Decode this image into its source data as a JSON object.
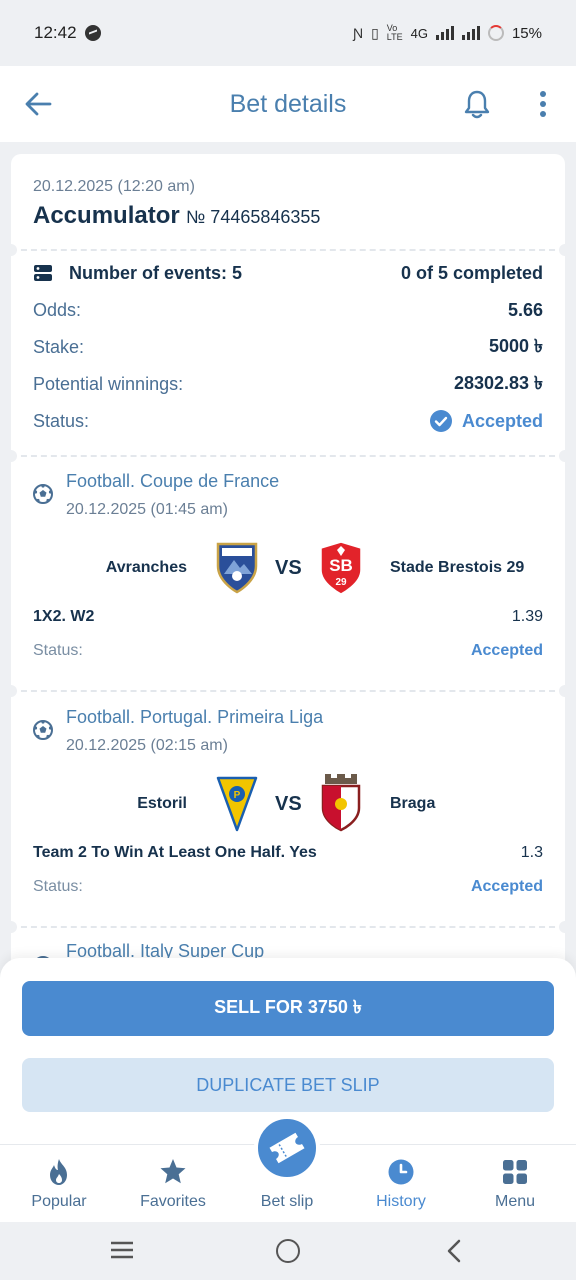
{
  "status_bar": {
    "time": "12:42",
    "network": "4G",
    "battery": "15%"
  },
  "header": {
    "title": "Bet details"
  },
  "bet": {
    "date": "20.12.2025 (12:20 am)",
    "type": "Accumulator",
    "number": "№ 74465846355",
    "events_label": "Number of events: 5",
    "completed": "0 of 5 completed",
    "odds_label": "Odds:",
    "odds_value": "5.66",
    "stake_label": "Stake:",
    "stake_value": "5000 ৳",
    "winnings_label": "Potential winnings:",
    "winnings_value": "28302.83 ৳",
    "status_label": "Status:",
    "status_value": "Accepted"
  },
  "events": [
    {
      "league": "Football. Coupe de France",
      "date": "20.12.2025 (01:45 am)",
      "home": "Avranches",
      "away": "Stade Brestois 29",
      "vs": "VS",
      "market": "1X2. W2",
      "odd": "1.39",
      "status_label": "Status:",
      "status_value": "Accepted"
    },
    {
      "league": "Football. Portugal. Primeira Liga",
      "date": "20.12.2025 (02:15 am)",
      "home": "Estoril",
      "away": "Braga",
      "vs": "VS",
      "market": "Team 2 To Win At Least One Half. Yes",
      "odd": "1.3",
      "status_label": "Status:",
      "status_value": "Accepted"
    },
    {
      "league": "Football. Italy Super Cup"
    }
  ],
  "actions": {
    "sell": "SELL FOR 3750 ৳",
    "duplicate": "DUPLICATE BET SLIP"
  },
  "nav": [
    {
      "label": "Popular",
      "icon": "flame-icon"
    },
    {
      "label": "Favorites",
      "icon": "star-icon"
    },
    {
      "label": "Bet slip",
      "icon": "ticket-icon"
    },
    {
      "label": "History",
      "icon": "clock-icon"
    },
    {
      "label": "Menu",
      "icon": "grid-icon"
    }
  ],
  "colors": {
    "accent": "#4a8ad0",
    "title": "#4a7fae",
    "text": "#17324d",
    "background": "#eef0f3"
  }
}
